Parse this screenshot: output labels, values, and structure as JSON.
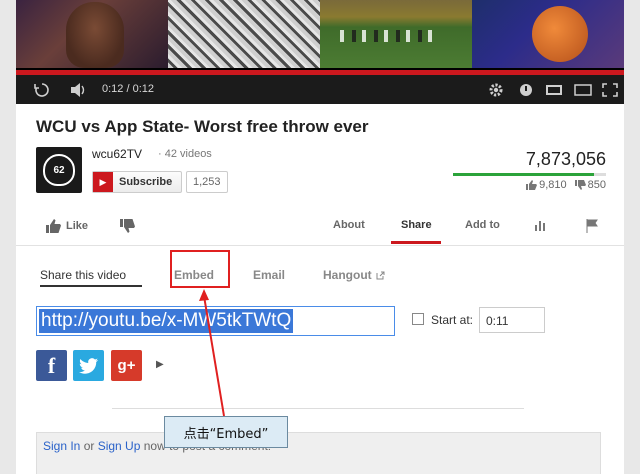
{
  "player": {
    "time": "0:12 / 0:12",
    "progress_fraction": 1.0,
    "icons": [
      "replay-icon",
      "volume-icon",
      "gear-icon",
      "annotations-icon",
      "small-player-icon",
      "large-player-icon",
      "fullscreen-icon"
    ]
  },
  "video": {
    "title": "WCU vs App State- Worst free throw ever",
    "channel_name": "wcu62TV",
    "video_count": "· 42 videos",
    "avatar_text": "62",
    "subscribe_label": "Subscribe",
    "subscriber_count": "1,253",
    "view_count": "7,873,056",
    "like_count": "9,810",
    "dislike_count": "850",
    "like_ratio": 0.92
  },
  "actions": {
    "like_label": "Like",
    "about_label": "About",
    "share_label": "Share",
    "addto_label": "Add to"
  },
  "share": {
    "tabs": [
      "Share this video",
      "Embed",
      "Email",
      "Hangout"
    ],
    "url": "http://youtu.be/x-MW5tkTWtQ",
    "start_at_label": "Start at:",
    "start_at_value": "0:11",
    "social": [
      "f",
      "t",
      "g+"
    ]
  },
  "comment": {
    "sign_in": "Sign In",
    "or": " or ",
    "sign_up": "Sign Up",
    "rest": " now to post a comment!"
  },
  "annotation": {
    "callout_text": "点击“Embed”",
    "colors": {
      "highlight": "#e02020",
      "callout_bg": "#dcebf5"
    }
  },
  "colors": {
    "accent": "#cc181e",
    "like_bar": "#2ba33a",
    "link": "#2a62c9",
    "selection": "#3b78d8"
  }
}
